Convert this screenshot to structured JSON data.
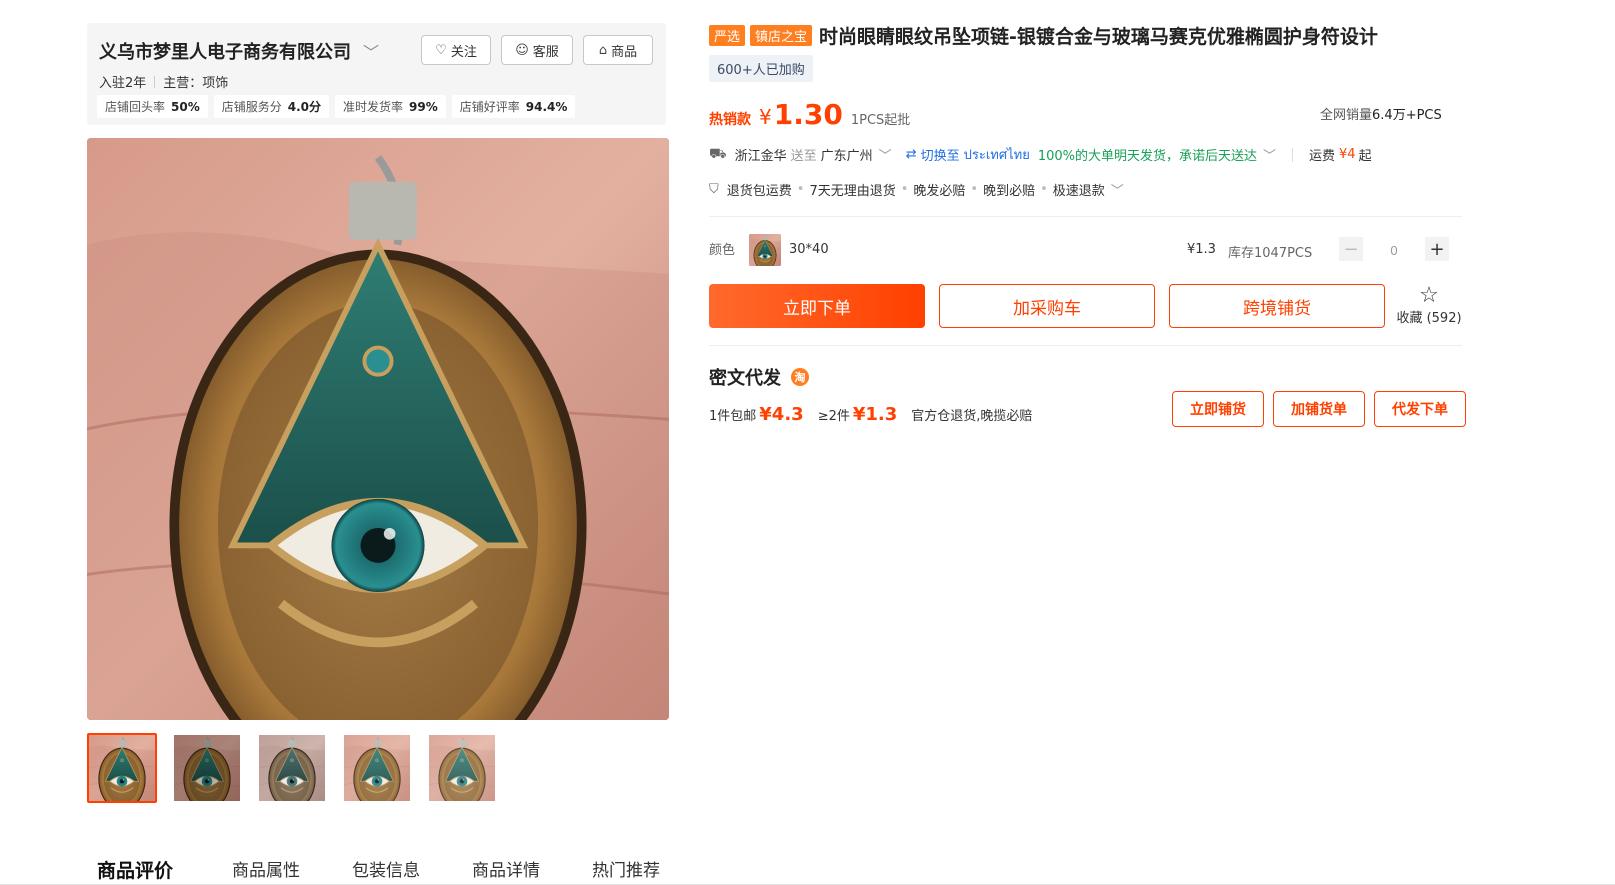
{
  "shop": {
    "name": "义乌市梦里人电子商务有限公司",
    "follow_label": "关注",
    "service_label": "客服",
    "products_label": "商品",
    "years": "入驻2年",
    "main_category": "主营：项饰",
    "stats": [
      {
        "label": "店铺回头率",
        "value": "50%"
      },
      {
        "label": "店铺服务分",
        "value": "4.0分"
      },
      {
        "label": "准时发货率",
        "value": "99%"
      },
      {
        "label": "店铺好评率",
        "value": "94.4%"
      }
    ]
  },
  "product": {
    "tag_yanxuan": "严选",
    "tag_zhen": "镇店之宝",
    "title": "时尚眼睛眼纹吊坠项链-银镀合金与玻璃马赛克优雅椭圆护身符设计",
    "buyers": "600+人已加购",
    "hot_label": "热销款",
    "currency": "¥",
    "price": "1.30",
    "moq": "1PCS起批",
    "sales_label": "全网销量",
    "sales_value": "6.4万+PCS"
  },
  "shipping": {
    "from": "浙江金华",
    "to_word": "送至",
    "to": "广东广州",
    "switch_label": "切换至",
    "switch_target": "ประเทศไทย",
    "promise": "100%的大单明天发货，承诺后天送达",
    "fee_label": "运费",
    "fee_value": "¥4",
    "fee_suffix": "起"
  },
  "services": [
    "退货包运费",
    "7天无理由退货",
    "晚发必赔",
    "晚到必赔",
    "极速退款"
  ],
  "sku": {
    "label": "颜色",
    "name": "30*40",
    "price": "¥1.3",
    "stock": "库存1047PCS",
    "qty": "0"
  },
  "actions": {
    "order": "立即下单",
    "cart": "加采购车",
    "cross": "跨境铺货",
    "fav_label": "收藏",
    "fav_count": "(592)"
  },
  "miwen": {
    "title": "密文代发",
    "icon": "淘",
    "one_label": "1件包邮",
    "one_price": "¥4.3",
    "two_label": "≥2件",
    "two_price": "¥1.3",
    "note": "官方仓退货,晚揽必赔",
    "btn_pu": "立即铺货",
    "btn_add": "加铺货单",
    "btn_daifa": "代发下单"
  },
  "tabs": [
    "商品评价",
    "商品属性",
    "包装信息",
    "商品详情",
    "热门推荐"
  ],
  "colors": {
    "accent": "#ff4000",
    "tag": "#ff7e1f",
    "link": "#1f6fe5",
    "ok": "#18a058"
  },
  "icons": [
    "chevron-down-icon",
    "heart-plus-icon",
    "chat-icon",
    "store-icon",
    "truck-icon",
    "switch-icon",
    "shield-icon",
    "star-icon"
  ]
}
